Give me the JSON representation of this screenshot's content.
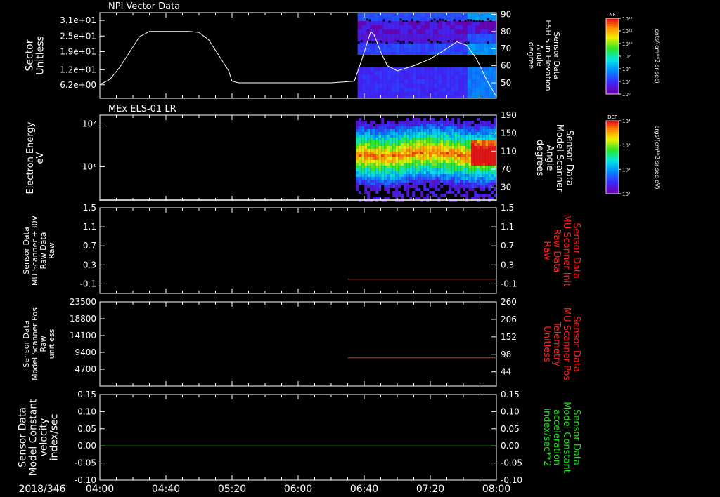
{
  "colors": {
    "background": "#000000",
    "frame": "#ffffff",
    "red": "#ff2020",
    "green": "#22dd22"
  },
  "time_axis": {
    "date_label": "2018/346",
    "ticks": [
      "04:00",
      "04:40",
      "05:20",
      "06:00",
      "06:40",
      "07:20",
      "08:00"
    ],
    "range_minutes": [
      240,
      480
    ]
  },
  "chart_data": [
    {
      "id": "panel1",
      "type": "heatmap",
      "title": "NPI Vector Data",
      "ylabel_lines": [
        "Sector",
        "Unitless"
      ],
      "ylim": [
        1,
        34
      ],
      "yticks": [
        "3.1e+01",
        "2.5e+01",
        "1.9e+01",
        "1.2e+01",
        "6.2e+00"
      ],
      "ytick_values": [
        31,
        25,
        19,
        12,
        6.2
      ],
      "right_label_lines": [
        "Sensor Data",
        "ESH Sun Elevation",
        "Angle",
        "degree"
      ],
      "right_yticks": [
        "90",
        "80",
        "70",
        "60",
        "50"
      ],
      "right_ylim": [
        41,
        91
      ],
      "data_start_minutes": 396,
      "overlay_line": {
        "name": "ESH Sun Elevation Angle",
        "x_minutes": [
          240,
          246,
          252,
          258,
          264,
          270,
          276,
          282,
          288,
          294,
          300,
          306,
          312,
          318,
          320,
          324,
          330,
          340,
          360,
          380,
          394,
          398,
          402,
          404,
          406,
          410,
          414,
          420,
          430,
          440,
          450,
          456,
          462,
          468,
          474,
          480
        ],
        "values": [
          49,
          52,
          59,
          68,
          77,
          80,
          80,
          80,
          80,
          80,
          79.5,
          75,
          66,
          57,
          51,
          50,
          50,
          50,
          50,
          50,
          51,
          62,
          74,
          80,
          78,
          68,
          60,
          57,
          60,
          64,
          70,
          74,
          72,
          64,
          52,
          42
        ]
      },
      "colorbar": {
        "label": "NF",
        "units": "cnts/(cm**2-sr-sec)",
        "ticks": [
          "10¹²",
          "10¹¹",
          "10¹⁰",
          "10⁹",
          "10⁸",
          "10⁷",
          "10⁶"
        ]
      }
    },
    {
      "id": "panel2",
      "type": "heatmap",
      "title": "MEx ELS-01 LR",
      "ylabel_lines": [
        "Electron Energy",
        "eV"
      ],
      "yscale": "log",
      "ylim": [
        1.6,
        160
      ],
      "yticks": [
        "10²",
        "10¹"
      ],
      "ytick_values": [
        100,
        10
      ],
      "right_label_lines": [
        "Sensor Data",
        "Model Scanner",
        "Angle",
        "degrees"
      ],
      "right_yticks": [
        "190",
        "150",
        "110",
        "70",
        "30"
      ],
      "right_ylim": [
        0,
        190
      ],
      "data_start_minutes": 395,
      "overlay_line": {
        "name": "Model Scanner Angle",
        "x_minutes": [
          240,
          480
        ],
        "values": [
          2,
          2
        ]
      },
      "colorbar": {
        "label": "DEF",
        "units": "ergs/(cm**2-sr-sec-eV)",
        "ticks": [
          "10⁴",
          "10³",
          "10²",
          "10¹"
        ]
      }
    },
    {
      "id": "panel3",
      "type": "line",
      "ylabel_lines": [
        "Sensor Data",
        "MU Scanner +30V",
        "Raw Data",
        "Raw"
      ],
      "ylim": [
        -0.3,
        1.5
      ],
      "yticks": [
        "1.5",
        "1.1",
        "0.7",
        "0.3",
        "-0.1"
      ],
      "ytick_values": [
        1.5,
        1.1,
        0.7,
        0.3,
        -0.1
      ],
      "right_label_lines": [
        "Sensor Data",
        "MU Scanner Init",
        "Raw Data",
        "Raw"
      ],
      "right_yticks": [
        "1.5",
        "1.1",
        "0.7",
        "0.3",
        "-0.1"
      ],
      "right_ylim": [
        -0.3,
        1.5
      ],
      "series": [
        {
          "name": "MU Scanner Init",
          "color": "#ff2020",
          "axis": "right",
          "x_minutes": [
            390,
            480
          ],
          "values": [
            0,
            0
          ]
        }
      ]
    },
    {
      "id": "panel4",
      "type": "line",
      "ylabel_lines": [
        "Sensor Data",
        "Model Scanner Pos",
        "Raw",
        "unitless"
      ],
      "ylim": [
        0,
        23500
      ],
      "yticks": [
        "23500",
        "18800",
        "14100",
        "9400",
        "4700"
      ],
      "ytick_values": [
        23500,
        18800,
        14100,
        9400,
        4700
      ],
      "right_label_lines": [
        "Sensor Data",
        "MU Scanner Pos",
        "Telemetry",
        "Unitless"
      ],
      "right_yticks": [
        "260",
        "206",
        "152",
        "98",
        "44"
      ],
      "right_ylim": [
        0,
        260
      ],
      "series": [
        {
          "name": "MU Scanner Pos",
          "color": "#ff2020",
          "axis": "right",
          "x_minutes": [
            390,
            480
          ],
          "values": [
            87,
            87
          ]
        }
      ]
    },
    {
      "id": "panel5",
      "type": "line",
      "ylabel_lines": [
        "Sensor Data",
        "Model Constant",
        "velocity",
        "index/sec"
      ],
      "ylim": [
        -0.1,
        0.15
      ],
      "yticks": [
        "0.15",
        "0.10",
        "0.05",
        "0.00",
        "-0.05",
        "-0.10"
      ],
      "ytick_values": [
        0.15,
        0.1,
        0.05,
        0.0,
        -0.05,
        -0.1
      ],
      "right_label_lines": [
        "Sensor Data",
        "Model Constant",
        "acceleration",
        "index/sec**2"
      ],
      "right_yticks": [
        "0.15",
        "0.10",
        "0.05",
        "0.00",
        "-0.05",
        "-0.10"
      ],
      "right_ylim": [
        -0.1,
        0.15
      ],
      "series": [
        {
          "name": "Model Constant acceleration",
          "color": "#22dd22",
          "axis": "right",
          "x_minutes": [
            240,
            480
          ],
          "values": [
            0,
            0
          ]
        }
      ]
    }
  ]
}
